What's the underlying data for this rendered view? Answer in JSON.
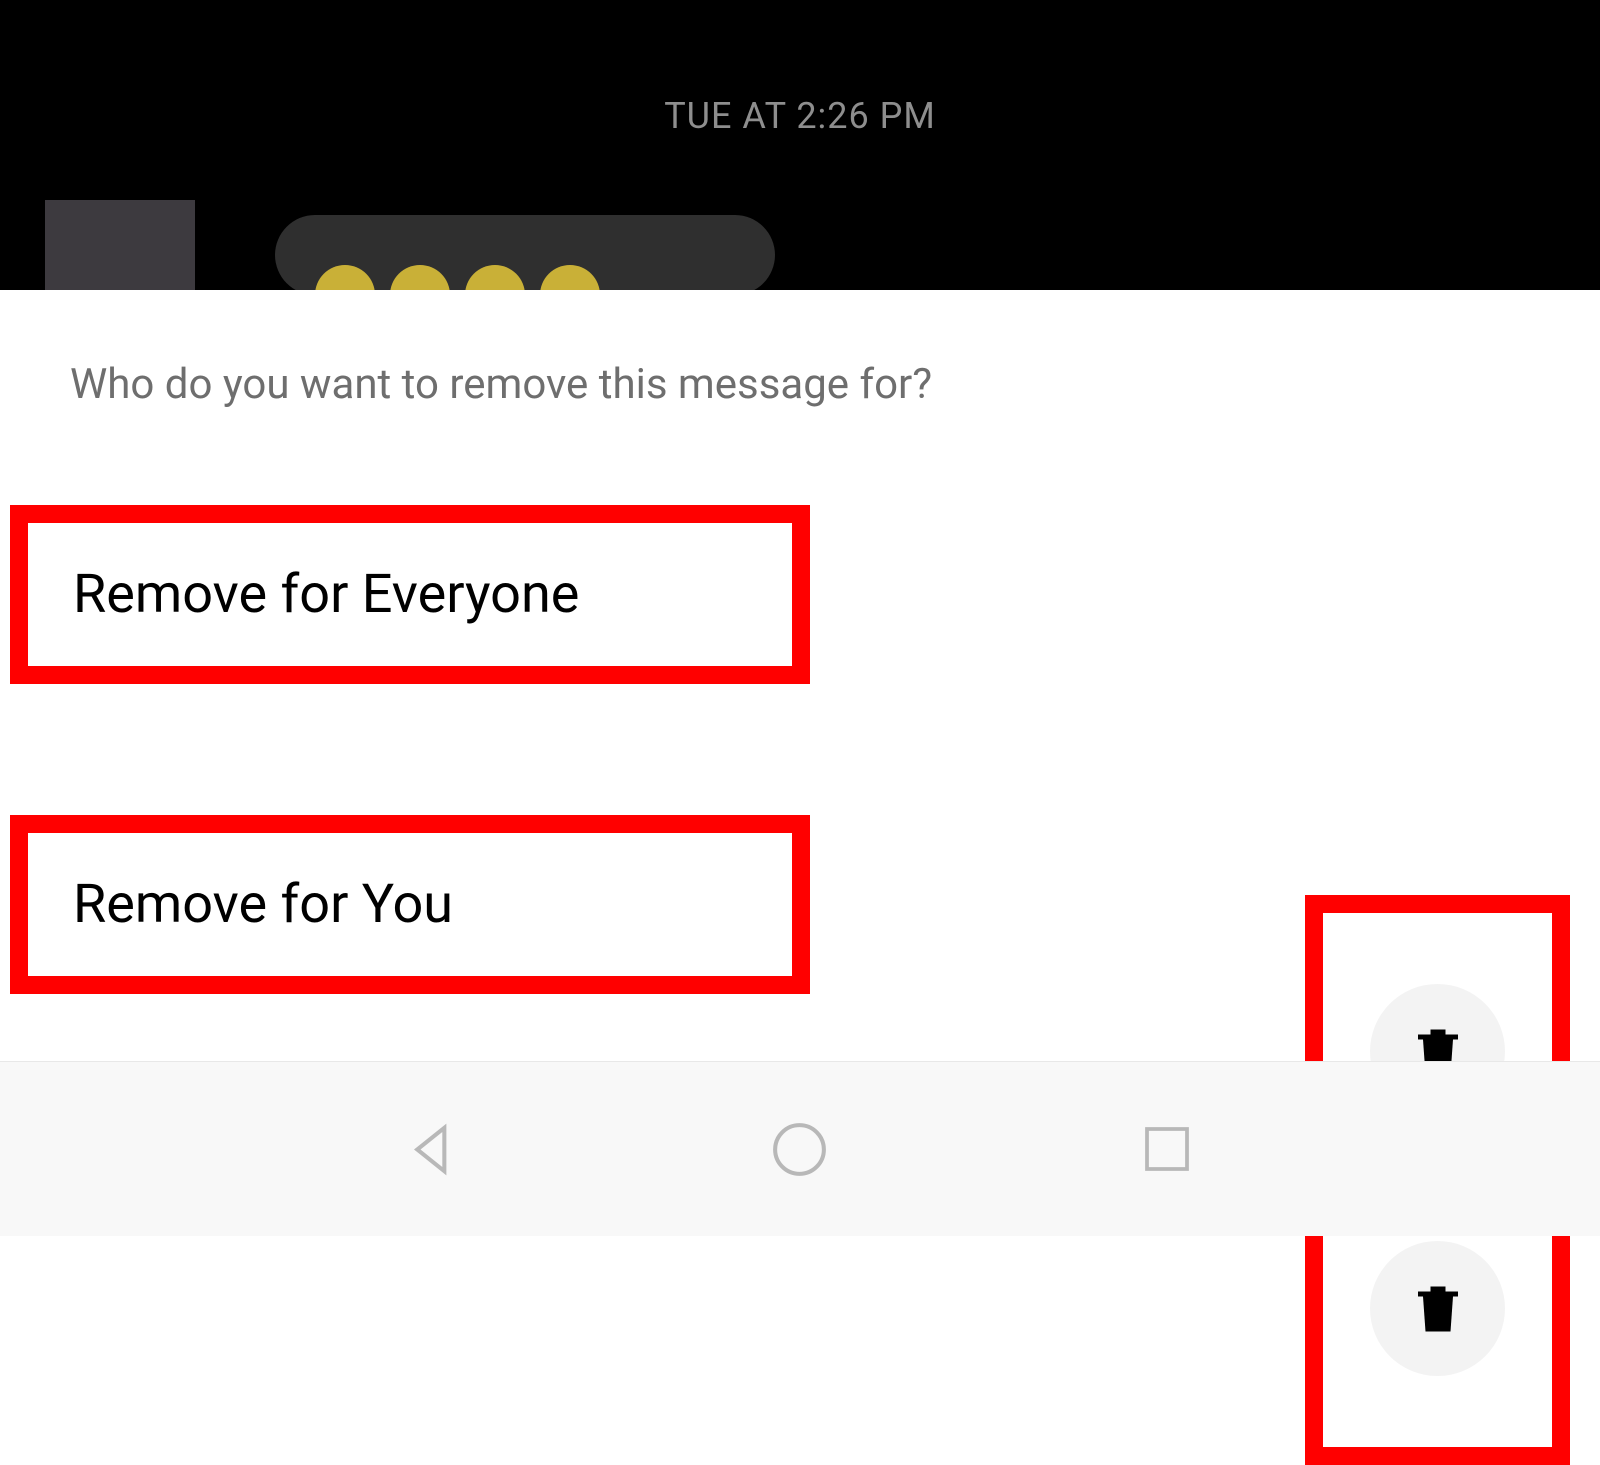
{
  "chat": {
    "timestamp": "TUE AT 2:26 PM"
  },
  "dialog": {
    "title": "Who do you want to remove this message for?",
    "options": [
      {
        "label": "Remove for Everyone"
      },
      {
        "label": "Remove for You"
      }
    ]
  },
  "icons": {
    "trash": "trash-icon",
    "back": "back-icon",
    "home": "home-icon",
    "recent": "recent-icon"
  }
}
